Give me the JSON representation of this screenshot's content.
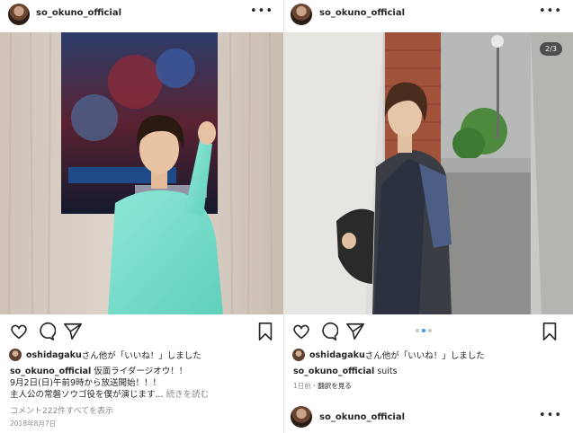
{
  "colors": {
    "accent": "#3897f0",
    "text": "#262626",
    "muted": "#8e8e8e"
  },
  "left_post": {
    "username": "so_okuno_official",
    "more_icon": "more-dots-icon",
    "likes_user": "oshidagaku",
    "likes_suffix": "さん他が「いいね！」しました",
    "caption_user": "so_okuno_official",
    "caption_line1": "仮面ライダージオウ！！",
    "caption_line2": "9月2日(日)午前9時から放送開始！！！",
    "caption_line3": "主人公の常磐ソウゴ役を僕が演じます...",
    "read_more": "続きを読む",
    "view_comments": "コメント222件すべてを表示",
    "date": "2018年8月7日",
    "icons": [
      "heart-icon",
      "comment-icon",
      "share-icon",
      "bookmark-icon"
    ]
  },
  "right_post": {
    "username": "so_okuno_official",
    "more_icon": "more-dots-icon",
    "counter": "2/3",
    "carousel": {
      "total": 3,
      "active": 2
    },
    "likes_user": "oshidagaku",
    "likes_suffix": "さん他が「いいね！」しました",
    "caption_user": "so_okuno_official",
    "caption_text": "suits",
    "time_ago": "1日前",
    "separator": "・",
    "translate": "翻訳を見る",
    "icons": [
      "heart-icon",
      "comment-icon",
      "share-icon",
      "bookmark-icon"
    ]
  },
  "next_post": {
    "username": "so_okuno_official"
  }
}
